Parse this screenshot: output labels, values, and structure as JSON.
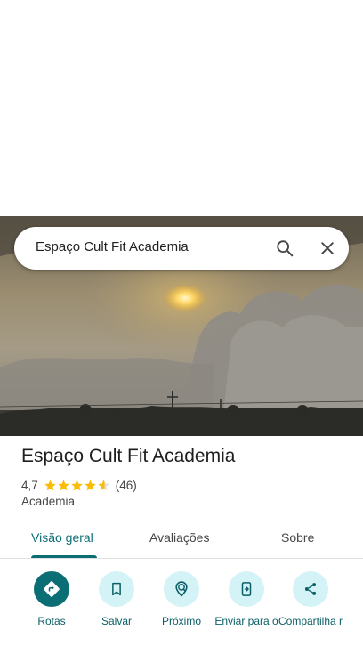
{
  "search": {
    "query": "Espaço Cult Fit Academia",
    "search_icon": "search-icon",
    "close_icon": "close-icon"
  },
  "place": {
    "name": "Espaço Cult Fit Academia",
    "rating": "4,7",
    "stars": 4.7,
    "review_count": "(46)",
    "category": "Academia"
  },
  "tabs": [
    {
      "label": "Visão geral",
      "active": true
    },
    {
      "label": "Avaliações",
      "active": false
    },
    {
      "label": "Sobre",
      "active": false
    }
  ],
  "actions": [
    {
      "label": "Rotas",
      "icon": "directions-icon"
    },
    {
      "label": "Salvar",
      "icon": "bookmark-icon"
    },
    {
      "label": "Próximo",
      "icon": "nearby-icon"
    },
    {
      "label": "Enviar para o",
      "icon": "send-to-phone-icon"
    },
    {
      "label": "Compartilha r",
      "icon": "share-icon"
    }
  ],
  "colors": {
    "accent": "#0b6e74",
    "action_bg": "#d3f3f6",
    "star": "#fbbc04"
  }
}
